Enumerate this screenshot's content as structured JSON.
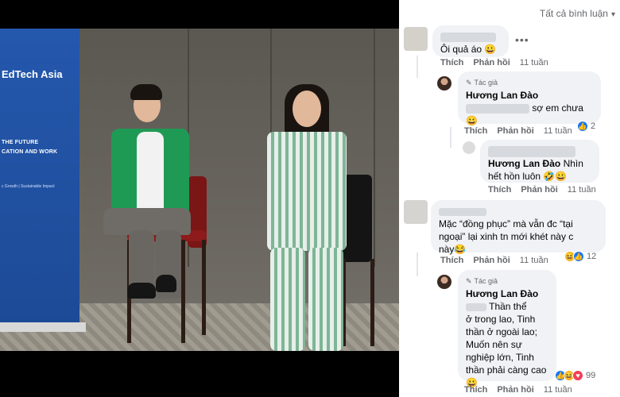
{
  "photo": {
    "banner": {
      "title": "EdTech Asia",
      "line1": "THE FUTURE",
      "line2": "CATION AND WORK",
      "sub": "c Growth | Sustainable Impact"
    }
  },
  "comments": {
    "sort_label": "Tất cả bình luận",
    "items": [
      {
        "text": "Ôi quả áo 😀",
        "actions": {
          "like": "Thích",
          "reply": "Phản hồi",
          "time": "11 tuần"
        }
      },
      {
        "author_tag": "Tác giả",
        "author": "Hương Lan Đào",
        "text": "sợ em chưa",
        "emoji": "😀",
        "actions": {
          "like": "Thích",
          "reply": "Phản hồi",
          "time": "11 tuần"
        },
        "reaction_count": "2"
      },
      {
        "author": "Hương Lan Đào",
        "text_line1": "Nhìn",
        "text_line2": "hết hồn luôn 🤣😀",
        "actions": {
          "like": "Thích",
          "reply": "Phản hồi",
          "time": "11 tuần"
        }
      },
      {
        "text_line1": "Mặc “đồng phục” mà vẫn đc “tại",
        "text_line2": "ngoại” lại xinh tn mới khét này c",
        "text_line3": "này😂",
        "actions": {
          "like": "Thích",
          "reply": "Phản hồi",
          "time": "11 tuần"
        },
        "reaction_count": "12"
      },
      {
        "author_tag": "Tác giả",
        "author": "Hương Lan Đào",
        "lines": [
          "Thần thể",
          "ở trong lao, Tinh",
          "thần ở ngoài lao;",
          "Muốn nên sự",
          "nghiệp lớn, Tinh",
          "thần phải càng cao",
          "😀"
        ],
        "actions": {
          "like": "Thích",
          "reply": "Phản hồi",
          "time": "11 tuần"
        },
        "reaction_count": "99"
      }
    ]
  }
}
